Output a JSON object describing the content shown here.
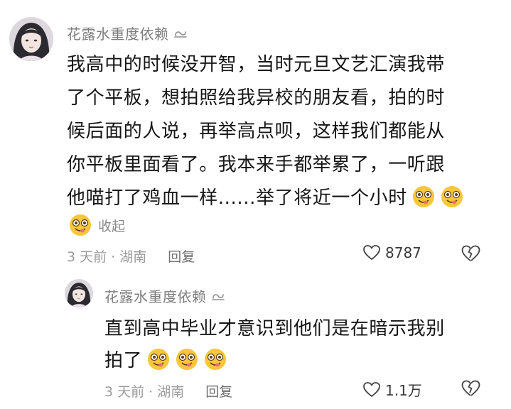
{
  "comment": {
    "username": "花露水重度依赖",
    "badge_icon": "loop-badge-icon",
    "lines": [
      "我高中的时候没开智，当时元旦文艺汇演我带",
      "了个平板，想拍照给我异校的朋友看，拍的时",
      "候后面的人说，再举高点呗，这样我们都能从",
      "你平板里面看了。我本来手都举累了，一听跟",
      "他喵打了鸡血一样......举了将近一个小时"
    ],
    "trailing_emoji": "smiling-face-with-heart-eyes-tongue-emoji",
    "collapse_label": "收起",
    "time_location": "3 天前 · 湖南",
    "reply_label": "回复",
    "like_count": "8787"
  },
  "reply": {
    "username": "花露水重度依赖",
    "badge_icon": "loop-badge-icon",
    "lines": [
      "直到高中毕业才意识到他们是在暗示我别",
      "拍了"
    ],
    "emoji_count": 3,
    "time_location": "3 天前 · 湖南",
    "reply_label": "回复",
    "like_count": "1.1万"
  },
  "colors": {
    "username": "#7d7d7d",
    "body_text": "#161616",
    "meta_text": "#9b9b9b",
    "emoji_face": "#f7c63a"
  }
}
